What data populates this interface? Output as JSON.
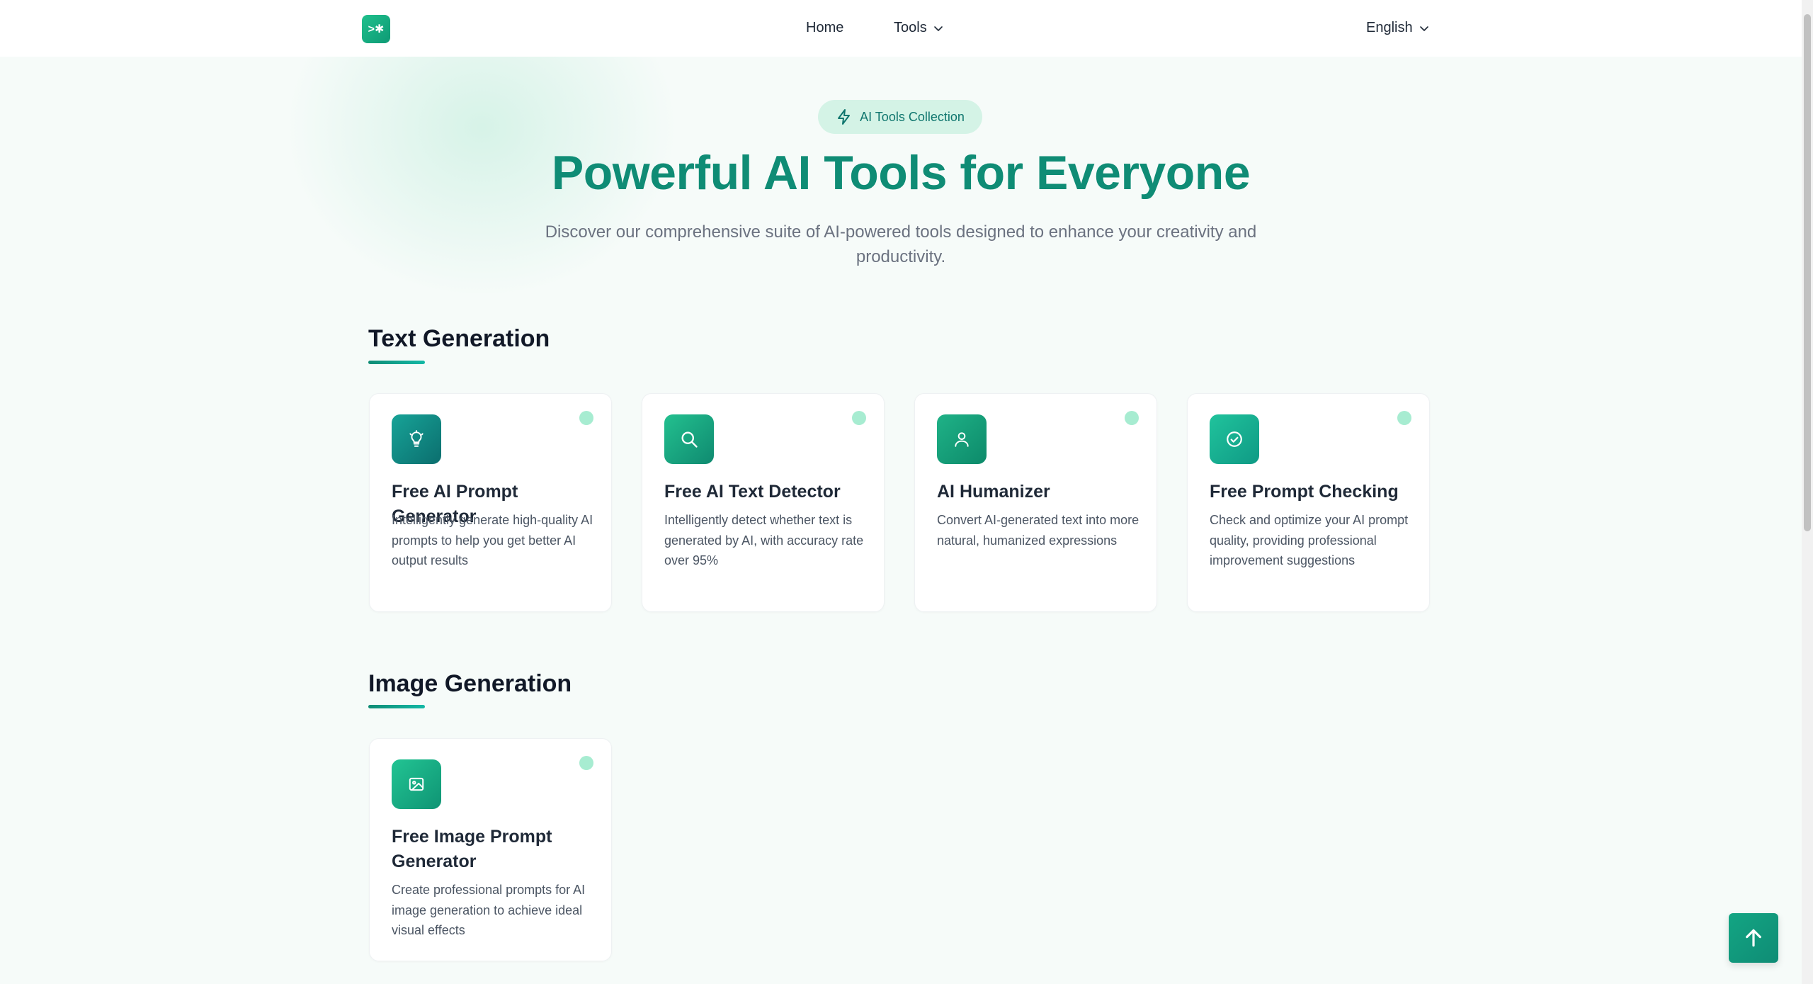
{
  "header": {
    "logo_text": ">✱",
    "nav": {
      "home": "Home",
      "tools": "Tools"
    },
    "language": "English"
  },
  "hero": {
    "badge": "AI Tools Collection",
    "title": "Powerful AI Tools for Everyone",
    "subtitle_line1": "Discover our comprehensive suite of AI-powered tools designed to enhance your creativity and",
    "subtitle_line2": "productivity."
  },
  "sections": [
    {
      "title": "Text Generation",
      "cards": [
        {
          "title": "Free AI Prompt Generator",
          "description": "Intelligently generate high-quality AI prompts to help you get better AI output results",
          "icon": "lightbulb-icon"
        },
        {
          "title": "Free AI Text Detector",
          "description": "Intelligently detect whether text is generated by AI, with accuracy rate over 95%",
          "icon": "search-icon"
        },
        {
          "title": "AI Humanizer",
          "description": "Convert AI-generated text into more natural, humanized expressions",
          "icon": "user-icon"
        },
        {
          "title": "Free Prompt Checking",
          "description": "Check and optimize your AI prompt quality, providing professional improvement suggestions",
          "icon": "check-circle-icon"
        }
      ]
    },
    {
      "title": "Image Generation",
      "cards": [
        {
          "title": "Free Image Prompt Generator",
          "description": "Create professional prompts for AI image generation to achieve ideal visual effects",
          "icon": "image-icon"
        }
      ]
    }
  ],
  "colors": {
    "accent": "#0f8c75",
    "badge_bg": "#d4f3e6",
    "status_dot": "#a7ecd1"
  }
}
